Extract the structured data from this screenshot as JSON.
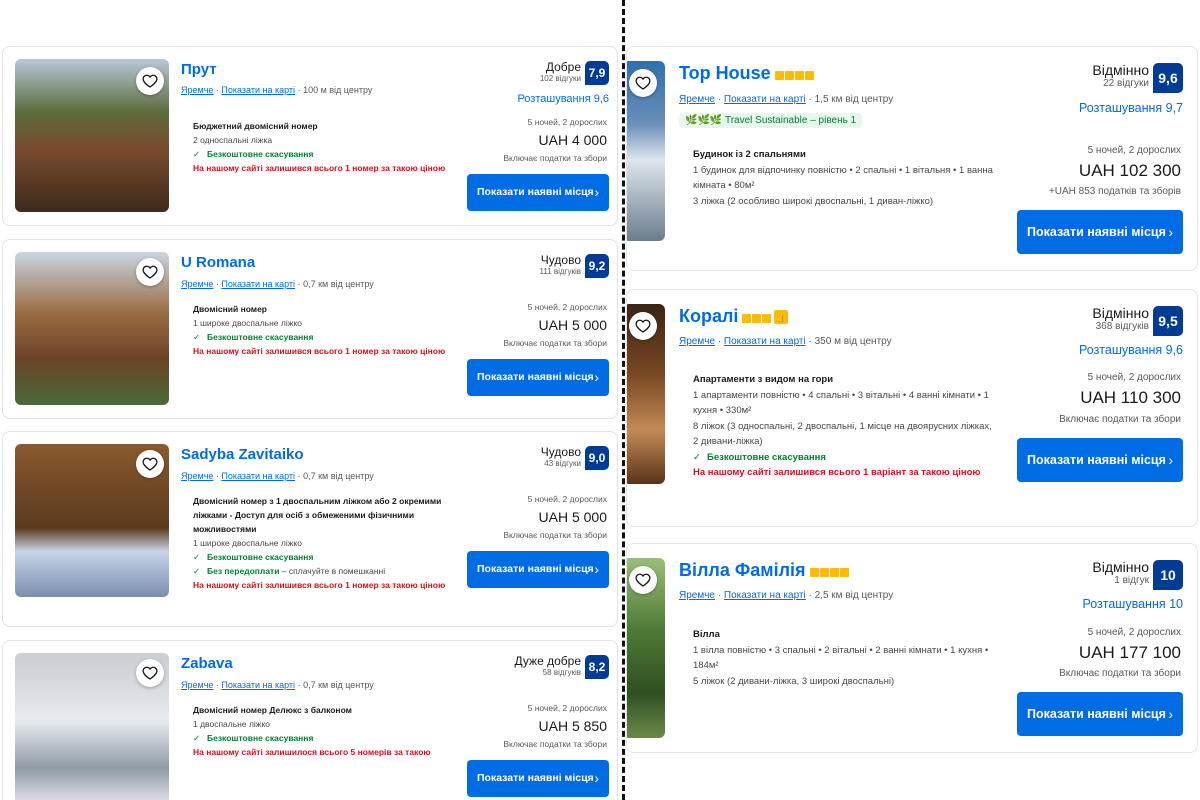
{
  "left_listings": [
    {
      "name": "Прут",
      "city": "Яремче",
      "map_link": "Показати на карті",
      "distance": "100 м від центру",
      "room_name": "Бюджетний двомісний номер",
      "beds": "2 односпальні ліжка",
      "cancellation": "Безкоштовне скасування",
      "scarcity": "На нашому сайті залишився всього 1 номер за такою ціною",
      "score_word": "Добре",
      "reviews": "102 відгуки",
      "score": "7,9",
      "location_score": "Розташування 9,6",
      "nights": "5 ночей, 2 дорослих",
      "price": "UAH 4 000",
      "taxes": "Включає податки та збори",
      "cta": "Показати наявні місця",
      "photo_colors": [
        "#5b6b3a",
        "#7a4a2e",
        "#b9c8d8"
      ]
    },
    {
      "name": "U Romana",
      "city": "Яремче",
      "map_link": "Показати на карті",
      "distance": "0,7 км від центру",
      "room_name": "Двомісний номер",
      "beds": "1 широке двоспальне ліжко",
      "cancellation": "Безкоштовне скасування",
      "scarcity": "На нашому сайті залишився всього 1 номер за такою ціною",
      "score_word": "Чудово",
      "reviews": "111 відгуків",
      "score": "9,2",
      "location_score": "",
      "nights": "5 ночей, 2 дорослих",
      "price": "UAH 5 000",
      "taxes": "Включає податки та збори",
      "cta": "Показати наявні місця",
      "photo_colors": [
        "#9a6b42",
        "#6b4428",
        "#c9d6e2"
      ]
    },
    {
      "name": "Sadyba Zavitaiko",
      "city": "Яремче",
      "map_link": "Показати на карті",
      "distance": "0,7 км від центру",
      "room_name": "Двомісний номер з 1 двоспальним ліжком або 2 окремими ліжками - Доступ для осіб з обмеженими фізичними можливостями",
      "beds": "1 широке двоспальне ліжко",
      "cancellation": "Безкоштовне скасування",
      "prepay": "Без передоплати",
      "prepay_note": "– сплачуйте в помешканні",
      "scarcity": "На нашому сайті залишився всього 1 номер за такою ціною",
      "score_word": "Чудово",
      "reviews": "43 відгуки",
      "score": "9,0",
      "location_score": "",
      "nights": "5 ночей, 2 дорослих",
      "price": "UAH 5 000",
      "taxes": "Включає податки та збори",
      "cta": "Показати наявні місця",
      "photo_colors": [
        "#8a5a2e",
        "#5a3a1e",
        "#c8d4e6"
      ]
    },
    {
      "name": "Zabava",
      "city": "Яремче",
      "map_link": "Показати на карті",
      "distance": "0,7 км від центру",
      "room_name": "Двомісний номер Делюкс з балконом",
      "beds": "1 двоспальне ліжко",
      "cancellation": "Безкоштовне скасування",
      "scarcity": "На нашому сайті залишилося всього 5 номерів за такою",
      "score_word": "Дуже добре",
      "reviews": "58 відгуків",
      "score": "8,2",
      "location_score": "",
      "nights": "5 ночей, 2 дорослих",
      "price": "UAH 5 850",
      "taxes": "Включає податки та збори",
      "cta": "Показати наявні місця",
      "photo_colors": [
        "#c9ced4",
        "#8f9aa6",
        "#e7eaee"
      ]
    }
  ],
  "right_listings": [
    {
      "name": "Top House",
      "city": "Яремче",
      "map_link": "Показати на карті",
      "distance": "1,5 км від центру",
      "sustainable": "Travel Sustainable – рівень 1",
      "room_name": "Будинок із 2 спальнями",
      "details": "1 будинок для відпочинку повністю • 2 спальні • 1 вітальня • 1 ванна кімната • 80м²",
      "beds": "3 ліжка (2 особливо широкі двоспальні, 1 диван-ліжко)",
      "score_word": "Відмінно",
      "reviews": "22 відгуки",
      "score": "9,6",
      "location_score": "Розташування 9,7",
      "nights": "5 ночей, 2 дорослих",
      "price": "UAH 102 300",
      "taxes": "+UAH 853 податків та зборів",
      "cta": "Показати наявні місця",
      "photo_colors": [
        "#2f6fb0",
        "#dde6ee",
        "#6b7d8c"
      ]
    },
    {
      "name": "Коралі",
      "city": "Яремче",
      "map_link": "Показати на карті",
      "distance": "350 м від центру",
      "room_name": "Апартаменти з видом на гори",
      "details": "1 апартаменти повністю • 4 спальні • 3 вітальні • 4 ванні кімнати • 1 кухня • 330м²",
      "beds": "8 ліжок (3 односпальні, 2 двоспальні, 1 місце на двоярусних ліжках, 2 дивани-ліжка)",
      "cancellation": "Безкоштовне скасування",
      "scarcity": "На нашому сайті залишився всього 1 варіант за такою ціною",
      "score_word": "Відмінно",
      "reviews": "368 відгуків",
      "score": "9,5",
      "location_score": "Розташування 9,6",
      "nights": "5 ночей, 2 дорослих",
      "price": "UAH 110 300",
      "taxes": "Включає податки та збори",
      "cta": "Показати наявні місця",
      "photo_colors": [
        "#7a4a24",
        "#3a2414",
        "#c28a55"
      ]
    },
    {
      "name": "Вілла Фамілія",
      "city": "Яремче",
      "map_link": "Показати на карті",
      "distance": "2,5 км від центру",
      "room_name": "Вілла",
      "details": "1 вілла повністю • 3 спальні • 2 вітальні • 2 ванні кімнати • 1 кухня • 184м²",
      "beds": "5 ліжок (2 дивани-ліжка, 3 широкі двоспальні)",
      "score_word": "Відмінно",
      "reviews": "1 відгук",
      "score": "10",
      "location_score": "Розташування 10",
      "nights": "5 ночей, 2 дорослих",
      "price": "UAH 177 100",
      "taxes": "Включає податки та збори",
      "cta": "Показати наявні місця",
      "photo_colors": [
        "#4f7a35",
        "#2f4f22",
        "#9bbf7a"
      ]
    }
  ]
}
